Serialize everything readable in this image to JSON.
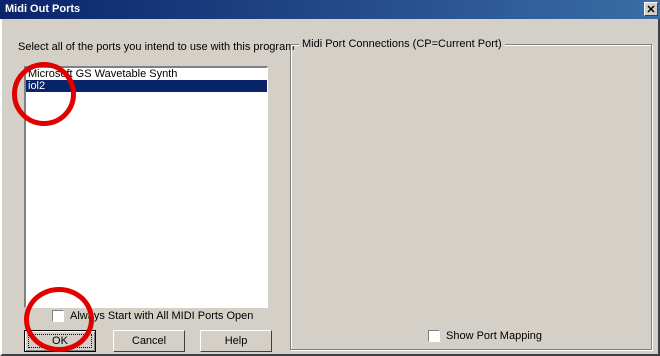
{
  "window": {
    "title": "Midi Out Ports",
    "close_glyph": "✕"
  },
  "ports_panel": {
    "instruction": "Select all of the ports you intend to use with this program",
    "items": [
      {
        "label": "Microsoft GS Wavetable Synth",
        "selected": false
      },
      {
        "label": "iol2",
        "selected": true
      }
    ],
    "always_open_checkbox": {
      "label": "Always Start with All MIDI Ports Open",
      "checked": false
    }
  },
  "connections_panel": {
    "group_label": "Midi Port Connections (CP=Current Port)",
    "show_mapping_checkbox": {
      "label": "Show Port Mapping",
      "checked": false
    }
  },
  "buttons": {
    "ok": "OK",
    "cancel": "Cancel",
    "help": "Help"
  },
  "annotations": {
    "highlight_color": "#e00000"
  }
}
